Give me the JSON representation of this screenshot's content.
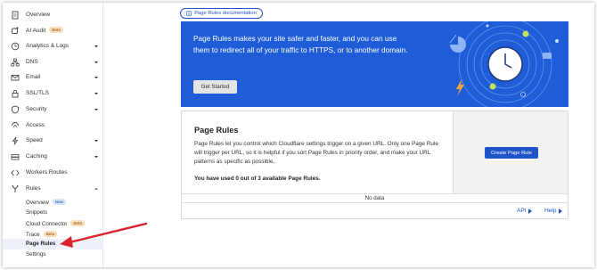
{
  "sidebar": {
    "items": [
      {
        "label": "Overview",
        "icon": "document-icon"
      },
      {
        "label": "AI Audit",
        "icon": "sparkle-icon",
        "badge": "Beta"
      },
      {
        "label": "Analytics & Logs",
        "icon": "clock-chart-icon"
      },
      {
        "label": "DNS",
        "icon": "network-icon"
      },
      {
        "label": "Email",
        "icon": "envelope-icon"
      },
      {
        "label": "SSL/TLS",
        "icon": "lock-icon"
      },
      {
        "label": "Security",
        "icon": "shield-icon"
      },
      {
        "label": "Access",
        "icon": "access-icon"
      },
      {
        "label": "Speed",
        "icon": "lightning-icon"
      },
      {
        "label": "Caching",
        "icon": "drive-icon"
      },
      {
        "label": "Workers Routes",
        "icon": "workers-icon"
      },
      {
        "label": "Rules",
        "icon": "rules-fork-icon"
      }
    ],
    "rules_subitems": [
      {
        "label": "Overview",
        "badge": "New"
      },
      {
        "label": "Snippets"
      },
      {
        "label": "Cloud Connector",
        "badge": "Beta"
      },
      {
        "label": "Trace",
        "badge": "Beta"
      },
      {
        "label": "Page Rules",
        "active": true
      },
      {
        "label": "Settings"
      }
    ]
  },
  "main": {
    "doc_link": "Page Rules documentation",
    "hero": {
      "text": "Page Rules makes your site safer and faster, and you can use them to redirect all of your traffic to HTTPS, or to another domain.",
      "button": "Get Started"
    },
    "card": {
      "title": "Page Rules",
      "description": "Page Rules let you control which Cloudflare settings trigger on a given URL. Only one Page Rule will trigger per URL, so it is helpful if you sort Page Rules in priority order, and make your URL patterns as specific as possible.",
      "usage": "You have used 0 out of 3 available Page Rules.",
      "create_button": "Create Page Rule",
      "empty_state": "No data",
      "api_link": "API",
      "help_link": "Help"
    }
  },
  "colors": {
    "brand_blue": "#1e5cd8",
    "link_blue": "#1f55c8",
    "annotation_red": "#d9232e"
  }
}
